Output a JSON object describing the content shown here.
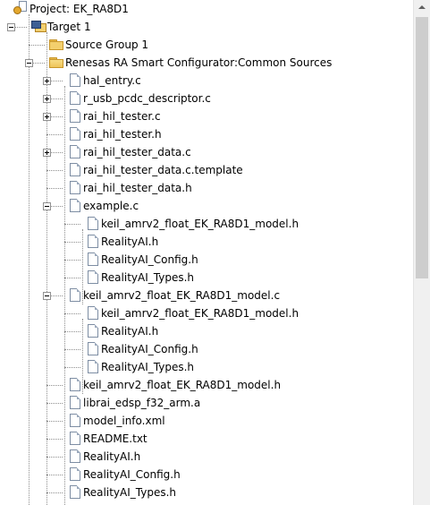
{
  "tree": [
    {
      "label": "Project: EK_RA8D1",
      "icon": "project-icon",
      "level": 0,
      "expander": "minus"
    },
    {
      "label": "Target 1",
      "icon": "target-icon",
      "level": 1,
      "expander": "minus"
    },
    {
      "label": "Source Group 1",
      "icon": "folder-icon",
      "level": 2,
      "expander": "none"
    },
    {
      "label": "Renesas RA Smart Configurator:Common Sources",
      "icon": "folder-open-icon",
      "level": 2,
      "expander": "minus"
    },
    {
      "label": "hal_entry.c",
      "icon": "file-icon",
      "level": 3,
      "expander": "plus"
    },
    {
      "label": "r_usb_pcdc_descriptor.c",
      "icon": "file-icon",
      "level": 3,
      "expander": "plus"
    },
    {
      "label": "rai_hil_tester.c",
      "icon": "file-icon",
      "level": 3,
      "expander": "plus"
    },
    {
      "label": "rai_hil_tester.h",
      "icon": "file-icon",
      "level": 3,
      "expander": "none"
    },
    {
      "label": "rai_hil_tester_data.c",
      "icon": "file-icon",
      "level": 3,
      "expander": "plus"
    },
    {
      "label": "rai_hil_tester_data.c.template",
      "icon": "file-icon",
      "level": 3,
      "expander": "none"
    },
    {
      "label": "rai_hil_tester_data.h",
      "icon": "file-icon",
      "level": 3,
      "expander": "none"
    },
    {
      "label": "example.c",
      "icon": "file-icon",
      "level": 3,
      "expander": "minus"
    },
    {
      "label": "keil_amrv2_float_EK_RA8D1_model.h",
      "icon": "file-icon",
      "level": 4,
      "expander": "none"
    },
    {
      "label": "RealityAI.h",
      "icon": "file-icon",
      "level": 4,
      "expander": "none"
    },
    {
      "label": "RealityAI_Config.h",
      "icon": "file-icon",
      "level": 4,
      "expander": "none"
    },
    {
      "label": "RealityAI_Types.h",
      "icon": "file-icon",
      "level": 4,
      "expander": "none"
    },
    {
      "label": "keil_amrv2_float_EK_RA8D1_model.c",
      "icon": "file-icon",
      "level": 3,
      "expander": "minus"
    },
    {
      "label": "keil_amrv2_float_EK_RA8D1_model.h",
      "icon": "file-icon",
      "level": 4,
      "expander": "none"
    },
    {
      "label": "RealityAI.h",
      "icon": "file-icon",
      "level": 4,
      "expander": "none"
    },
    {
      "label": "RealityAI_Config.h",
      "icon": "file-icon",
      "level": 4,
      "expander": "none"
    },
    {
      "label": "RealityAI_Types.h",
      "icon": "file-icon",
      "level": 4,
      "expander": "none"
    },
    {
      "label": "keil_amrv2_float_EK_RA8D1_model.h",
      "icon": "file-icon",
      "level": 3,
      "expander": "none"
    },
    {
      "label": "librai_edsp_f32_arm.a",
      "icon": "file-icon",
      "level": 3,
      "expander": "none"
    },
    {
      "label": "model_info.xml",
      "icon": "file-icon",
      "level": 3,
      "expander": "none"
    },
    {
      "label": "README.txt",
      "icon": "file-icon",
      "level": 3,
      "expander": "none"
    },
    {
      "label": "RealityAI.h",
      "icon": "file-icon",
      "level": 3,
      "expander": "none"
    },
    {
      "label": "RealityAI_Config.h",
      "icon": "file-icon",
      "level": 3,
      "expander": "none"
    },
    {
      "label": "RealityAI_Types.h",
      "icon": "file-icon",
      "level": 3,
      "expander": "none"
    }
  ],
  "scrollbar": {
    "up_icon": "scroll-up-arrow-icon"
  }
}
